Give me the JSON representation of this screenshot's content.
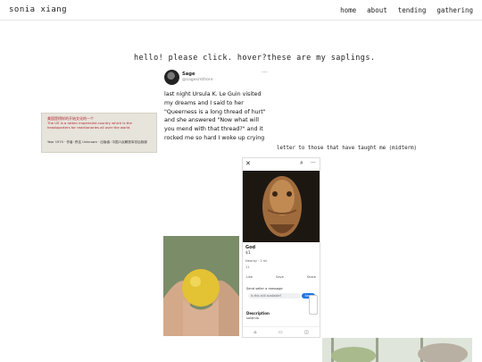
{
  "site": {
    "name": "sonia xiang",
    "nav": [
      "home",
      "about",
      "tending",
      "gathering"
    ]
  },
  "headline": "hello! please click. hover?these are my saplings.",
  "tweet": {
    "name": "Sage",
    "handle": "@sagesmthore",
    "text": "last night Ursula K. Le Guin visited my dreams and I said to her \"Queerness is a long thread of hurt\" and she answered \"Now what will you mend with that thread?\" and it rocked me so hard I woke up crying"
  },
  "sign": {
    "line1": "美国是榜样的开始文化的一个",
    "line2": "The US is a rotten imperialist country which is the headquarters for reactionaries all over the world",
    "line3": "Year 1970 · 作者: 佚名 Unknown · 出版者: 中国人民解放军总后勤部"
  },
  "letter_link": "letter to those that have taught me (midterm)",
  "phone": {
    "title": "God",
    "price": "$1",
    "location": "Nearby · 1 mi",
    "reactions": "11",
    "actions": [
      "Like",
      "Save",
      "Share"
    ],
    "send_label": "Send seller a message",
    "input_placeholder": "Is this still available?",
    "send_button": "Send",
    "description_label": "Description",
    "description_text": "salamia",
    "colors": {
      "accent": "#1b74e4"
    }
  },
  "colors": {
    "sign_red": "#b1252b",
    "text": "#222222"
  }
}
